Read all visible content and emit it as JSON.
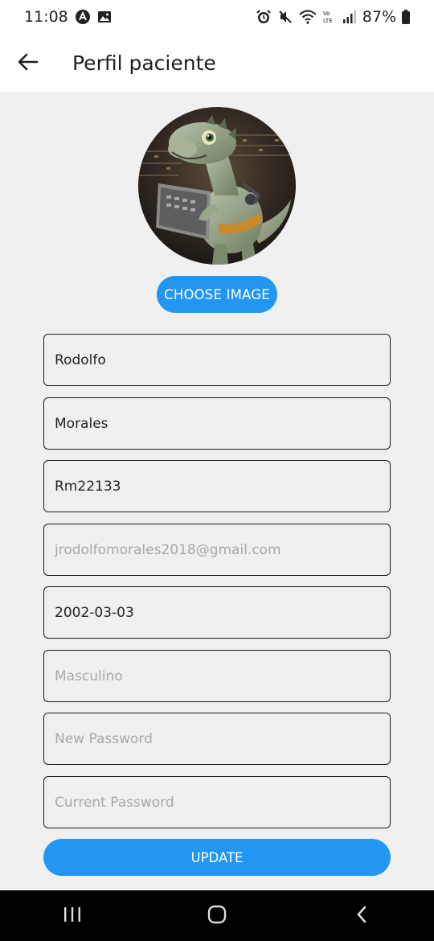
{
  "status_bar": {
    "time": "11:08",
    "battery": "87%",
    "icons": [
      "android-auto-icon",
      "image-icon",
      "alarm-icon",
      "mute-icon",
      "wifi-icon",
      "volte-icon",
      "signal-icon",
      "battery-icon"
    ]
  },
  "app_bar": {
    "title": "Perfil paciente",
    "back_icon": "arrow-left-icon"
  },
  "profile": {
    "choose_image_label": "CHOOSE IMAGE"
  },
  "form": {
    "first_name": "Rodolfo",
    "last_name": "Morales",
    "username": "Rm22133",
    "email_placeholder": "jrodolfomorales2018@gmail.com",
    "birth_date": "2002-03-03",
    "gender_placeholder": "Masculino",
    "new_password_placeholder": "New Password",
    "current_password_placeholder": "Current Password",
    "update_label": "UPDATE"
  },
  "colors": {
    "accent": "#2196f3",
    "background": "#f0f0f0",
    "border": "#1d1d1d"
  },
  "nav_bar": {
    "icons": [
      "recents-icon",
      "home-icon",
      "back-icon"
    ]
  }
}
